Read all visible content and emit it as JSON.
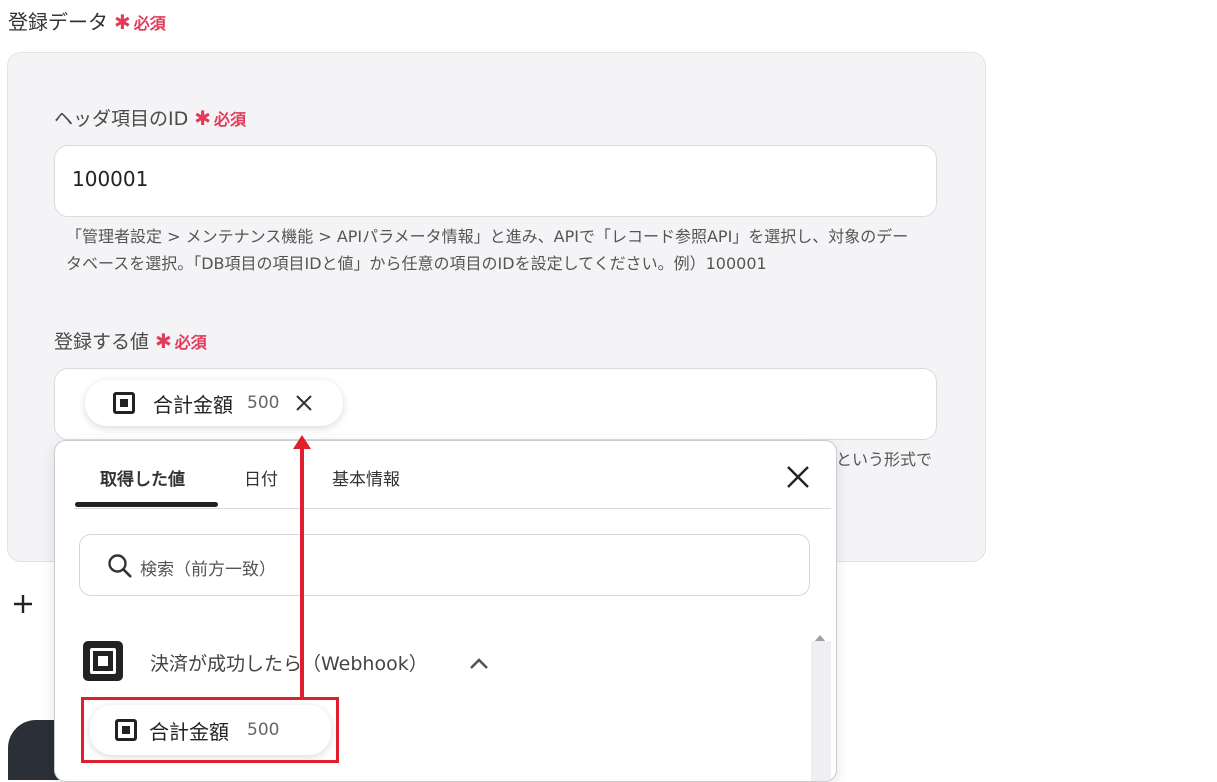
{
  "section": {
    "title": "登録データ",
    "required_label": "必須"
  },
  "header_id_field": {
    "label": "ヘッダ項目のID",
    "required_label": "必須",
    "value": "100001",
    "help_line1": "「管理者設定 > メンテナンス機能 > APIパラメータ情報」と進み、APIで「レコード参照API」を選択し、対象のデー",
    "help_line2": "タベースを選択。「DB項目の項目IDと値」から任意の項目のIDを設定してください。例）100001"
  },
  "value_field": {
    "label": "登録する値",
    "required_label": "必須",
    "chip": {
      "icon": "square-logo-icon",
      "label": "合計金額",
      "value": "500"
    },
    "help_tail": "という形式で"
  },
  "add_icon": "plus-icon",
  "dropdown": {
    "tabs": [
      "取得した値",
      "日付",
      "基本情報"
    ],
    "active_tab": 0,
    "search_placeholder": "検索（前方一致）",
    "group": {
      "icon": "square-logo-icon",
      "label": "決済が成功したら（Webhook）"
    },
    "item": {
      "label": "合計金額",
      "value": "500"
    }
  },
  "colors": {
    "required": "#e23b5a",
    "annotation": "#e01e2d",
    "panel_bg": "#f4f4f6"
  }
}
